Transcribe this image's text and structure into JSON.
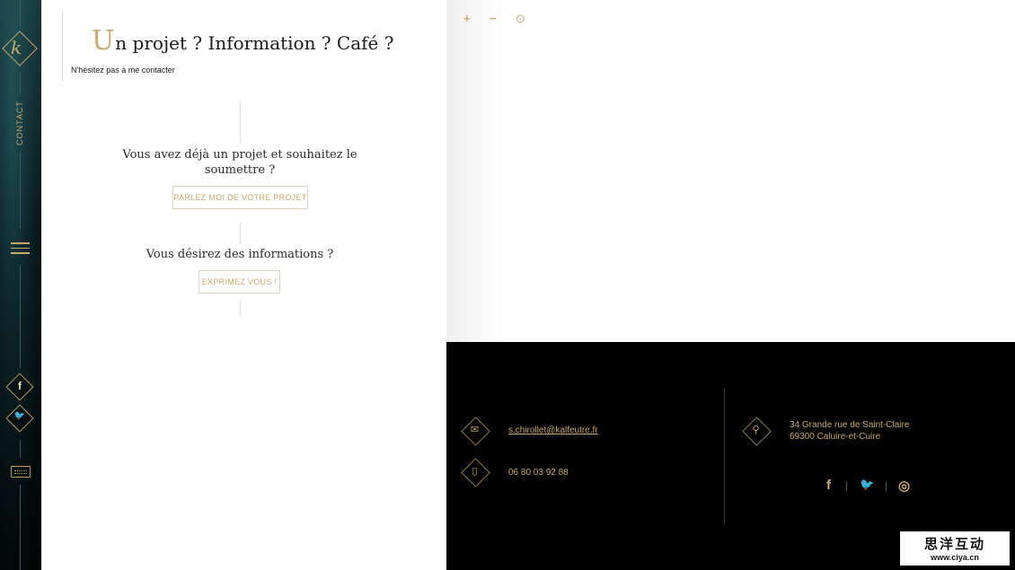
{
  "sidebar": {
    "logo_letter": "k",
    "section_label": "CONTACT",
    "menu_icon": "hamburger-icon",
    "facebook_icon": "f",
    "twitter_icon": "🐦",
    "keyboard_icon": "keyboard-icon",
    "accent_color": "#c8a86b"
  },
  "contact": {
    "title_dropcap": "U",
    "title_rest": "n projet ? Information ? Café ?",
    "subtitle": "N'hésitez pas à me contacter",
    "project_question": "Vous avez déjà un projet et souhaitez le soumettre ?",
    "project_button": "PARLEZ MOI DE VOTRE PROJET",
    "info_question": "Vous désirez des informations ?",
    "info_button": "EXPRIMEZ VOUS !"
  },
  "map": {
    "zoom_in": "+",
    "zoom_out": "−",
    "locate": "⊙"
  },
  "footer": {
    "email": "s.chirollet@kalfeutre.fr",
    "phone": "06 80 03 92 88",
    "address_line1": "34 Grande rue de Saint-Claire",
    "address_line2": "69300 Caluire-et-Cuire",
    "mail_icon": "✉",
    "phone_icon": "▯",
    "pin_icon": "⚲",
    "social_facebook": "f",
    "social_twitter": "🐦",
    "social_instagram": "◎"
  },
  "watermark": {
    "chinese": "思洋互动",
    "url": "www.ciya.cn"
  }
}
